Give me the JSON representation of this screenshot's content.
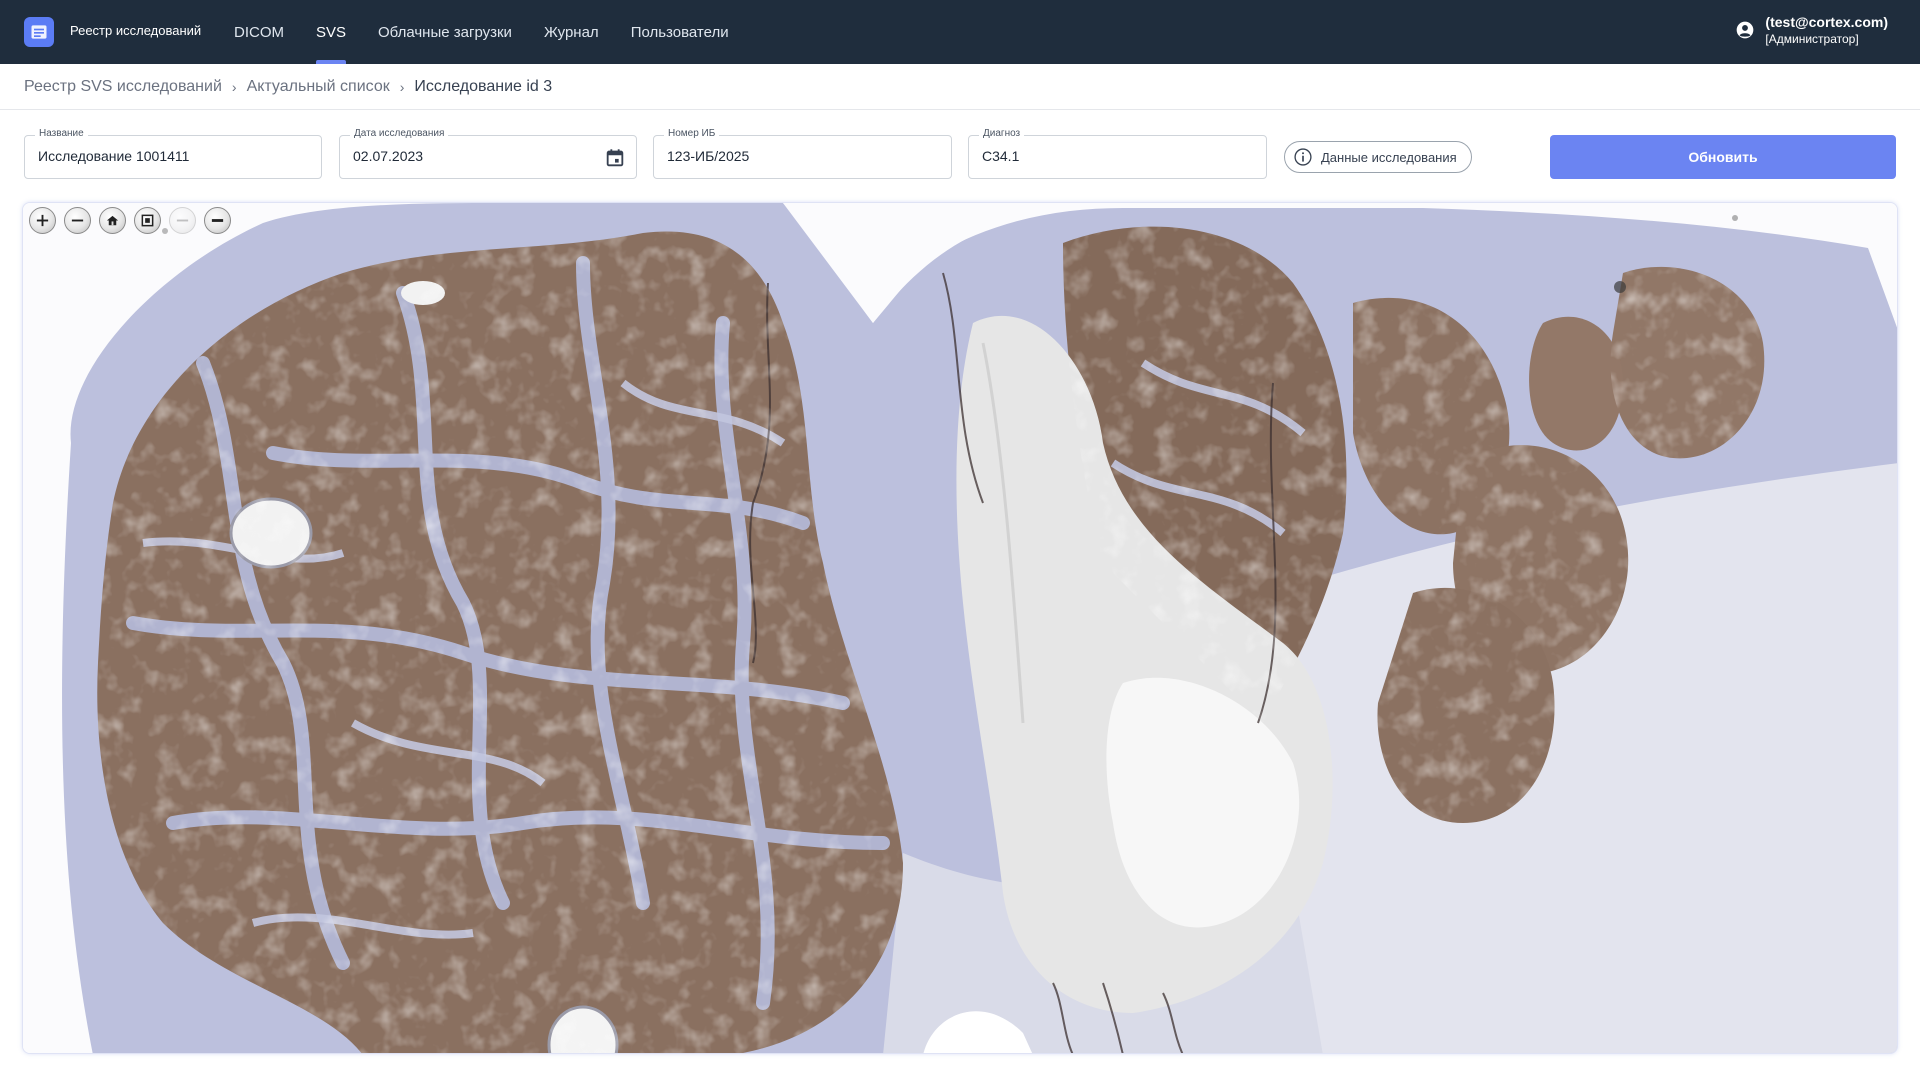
{
  "app": {
    "title": "Реестр исследований"
  },
  "nav": [
    {
      "label": "DICOM",
      "active": false
    },
    {
      "label": "SVS",
      "active": true
    },
    {
      "label": "Облачные загрузки",
      "active": false
    },
    {
      "label": "Журнал",
      "active": false
    },
    {
      "label": "Пользователи",
      "active": false
    }
  ],
  "user": {
    "email": "(test@cortex.com)",
    "role": "[Администратор]"
  },
  "breadcrumbs": [
    "Реестр SVS исследований",
    "Актуальный список",
    "Исследование id 3"
  ],
  "form": {
    "name": {
      "label": "Название",
      "value": "Исследование 1001411"
    },
    "date": {
      "label": "Дата исследования",
      "value": "02.07.2023"
    },
    "ib": {
      "label": "Номер ИБ",
      "value": "123-ИБ/2025"
    },
    "diagnosis": {
      "label": "Диагноз",
      "value": "C34.1"
    }
  },
  "buttons": {
    "study_data": "Данные исследования",
    "update": "Обновить"
  },
  "viewer": {
    "toolbar": [
      "zoom-in-icon",
      "zoom-out-icon",
      "home-icon",
      "fullscreen-icon",
      "rotate-left-icon",
      "rotate-right-icon"
    ]
  },
  "colors": {
    "topbar": "#1f2d3d",
    "accent": "#6b84f2",
    "tumor": "#7d6456",
    "stroma": "#b8bddb"
  }
}
